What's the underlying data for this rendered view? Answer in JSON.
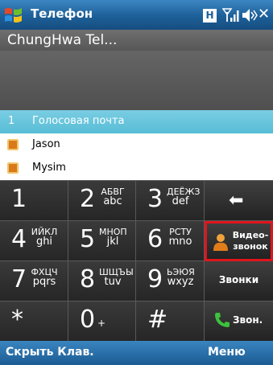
{
  "titlebar": {
    "title": "Телефон",
    "h_badge": "H",
    "close_glyph": "✕",
    "icons": [
      "windows-start-icon",
      "signal-icon",
      "volume-icon",
      "close-icon"
    ]
  },
  "operator": {
    "name": "ChungHwa Tel..."
  },
  "speed_dial": {
    "items": [
      {
        "number": "1",
        "label": "Голосовая почта"
      },
      {
        "label": "Jason"
      },
      {
        "label": "Mysim"
      }
    ]
  },
  "keypad": {
    "keys": [
      {
        "digit": "1",
        "letters_top": "",
        "letters_bottom": ""
      },
      {
        "digit": "2",
        "letters_top": "АБВГ",
        "letters_bottom": "abc"
      },
      {
        "digit": "3",
        "letters_top": "ДЕЁЖЗ",
        "letters_bottom": "def"
      },
      {
        "digit": "4",
        "letters_top": "ИЙКЛ",
        "letters_bottom": "ghi"
      },
      {
        "digit": "5",
        "letters_top": "МНОП",
        "letters_bottom": "jkl"
      },
      {
        "digit": "6",
        "letters_top": "РСТУ",
        "letters_bottom": "mno"
      },
      {
        "digit": "7",
        "letters_top": "ФХЦЧ",
        "letters_bottom": "pqrs"
      },
      {
        "digit": "8",
        "letters_top": "ШЩЪЫ",
        "letters_bottom": "tuv"
      },
      {
        "digit": "9",
        "letters_top": "ЬЭЮЯ",
        "letters_bottom": "wxyz"
      },
      {
        "digit": "*",
        "letters_top": "",
        "letters_bottom": ""
      },
      {
        "digit": "0",
        "letters_top": "",
        "letters_bottom": "+"
      },
      {
        "digit": "#",
        "letters_top": "",
        "letters_bottom": ""
      }
    ],
    "backspace_glyph": "⬅",
    "video_call_line1": "Видео-",
    "video_call_line2": "звонок",
    "calls_label": "Звонки",
    "call_label": "Звон."
  },
  "softkeys": {
    "left": "Скрыть Клав.",
    "right": "Меню"
  },
  "colors": {
    "titlebar": "#1d5f98",
    "selection": "#58bdd6",
    "keypad_bg": "#2f2f2f",
    "highlight_border": "#e0141c",
    "call_green": "#3cc23c"
  }
}
